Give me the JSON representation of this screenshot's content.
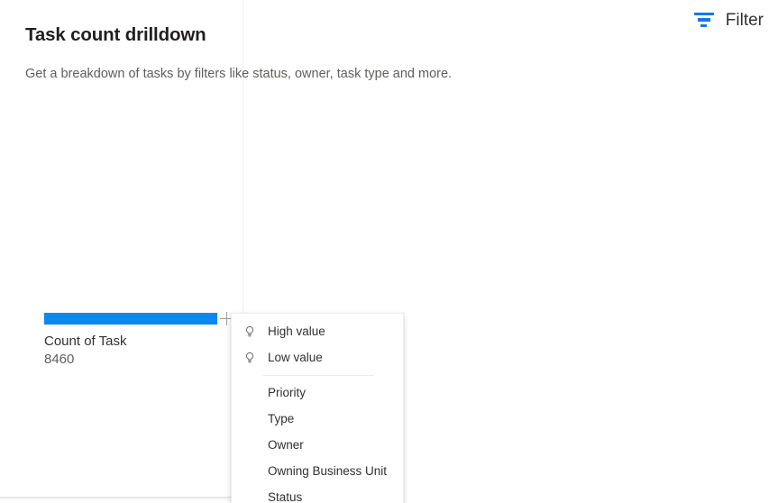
{
  "header": {
    "title": "Task count drilldown",
    "subtitle": "Get a breakdown of tasks by filters like status, owner, task type and more.",
    "filter_label": "Filter",
    "filter_icon": "filter-icon",
    "accent_color": "#0f7ae5"
  },
  "chart_data": {
    "type": "bar",
    "title": "Task count drilldown",
    "orientation": "horizontal",
    "categories": [
      "Count of Task"
    ],
    "values": [
      8460
    ],
    "value_labels": [
      "8460"
    ],
    "bar_color": "#0f86f0",
    "xlabel": "",
    "ylabel": "",
    "grid": false,
    "legend": "none",
    "nodes": [
      {
        "label": "Count of Task",
        "value": "8460",
        "expandable": true,
        "expand_icon": "plus-icon"
      }
    ]
  },
  "context_menu": {
    "open": true,
    "anchor": "Count of Task",
    "groups": [
      {
        "items": [
          {
            "label": "High value",
            "icon": "lightbulb-icon"
          },
          {
            "label": "Low value",
            "icon": "lightbulb-icon"
          }
        ]
      },
      {
        "items": [
          {
            "label": "Priority",
            "icon": ""
          },
          {
            "label": "Type",
            "icon": ""
          },
          {
            "label": "Owner",
            "icon": ""
          },
          {
            "label": "Owning Business Unit",
            "icon": ""
          },
          {
            "label": "Status",
            "icon": ""
          }
        ]
      }
    ]
  }
}
